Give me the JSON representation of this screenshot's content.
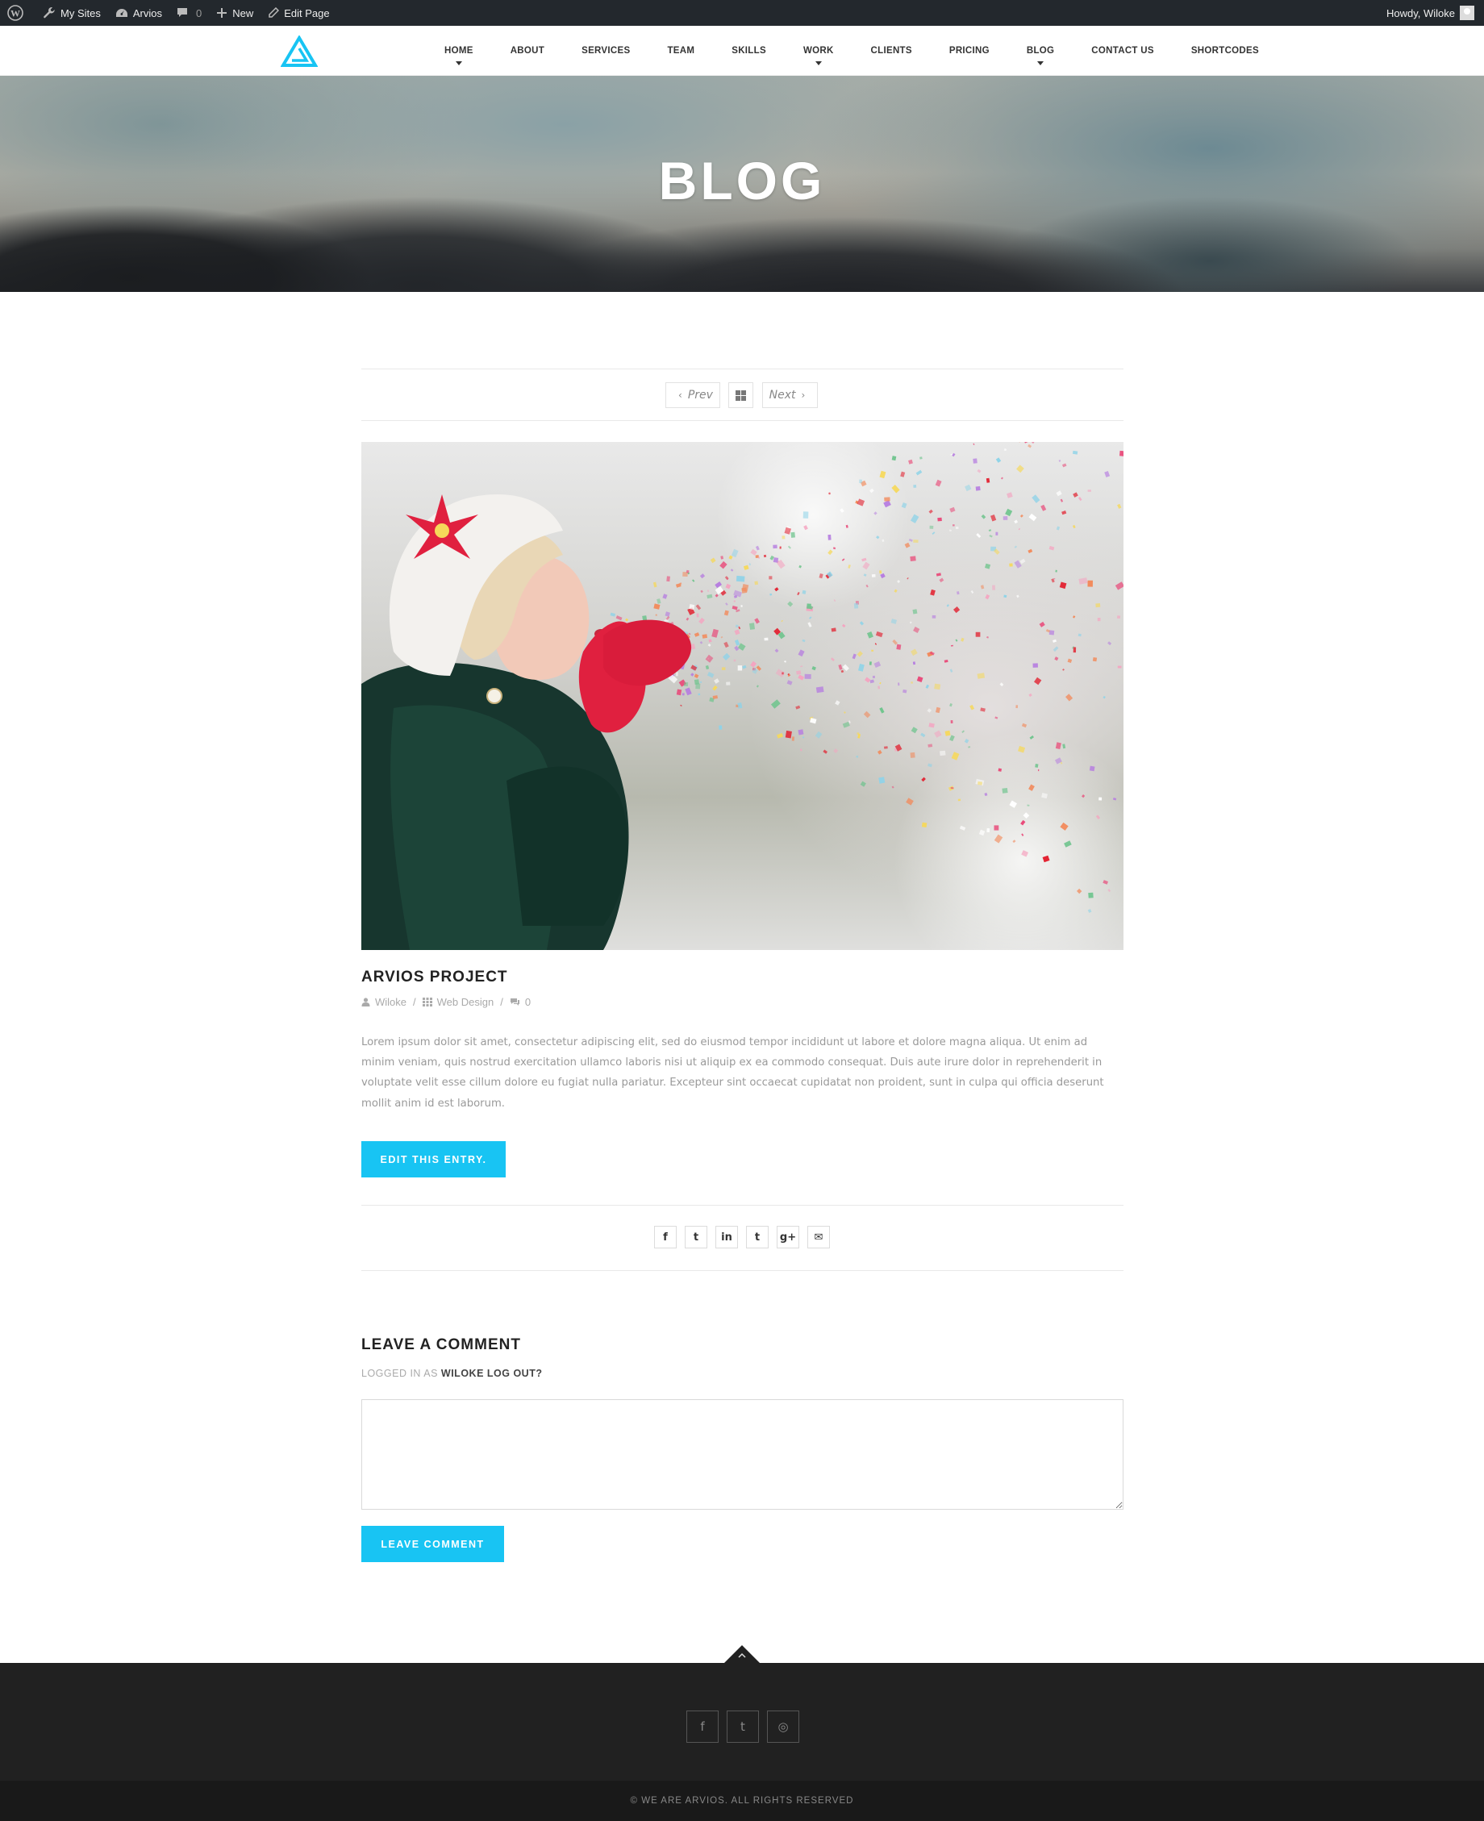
{
  "admin_bar": {
    "my_sites": "My Sites",
    "site_name": "Arvios",
    "comments_count": "0",
    "new_label": "New",
    "edit_page": "Edit Page",
    "greeting": "Howdy, Wiloke"
  },
  "nav": {
    "items": [
      {
        "label": "HOME",
        "has_submenu": true
      },
      {
        "label": "ABOUT",
        "has_submenu": false
      },
      {
        "label": "SERVICES",
        "has_submenu": false
      },
      {
        "label": "TEAM",
        "has_submenu": false
      },
      {
        "label": "SKILLS",
        "has_submenu": false
      },
      {
        "label": "WORK",
        "has_submenu": true
      },
      {
        "label": "CLIENTS",
        "has_submenu": false
      },
      {
        "label": "PRICING",
        "has_submenu": false
      },
      {
        "label": "BLOG",
        "has_submenu": true
      },
      {
        "label": "CONTACT US",
        "has_submenu": false
      },
      {
        "label": "SHORTCODES",
        "has_submenu": false
      }
    ]
  },
  "hero": {
    "title": "BLOG"
  },
  "post_nav": {
    "prev": "Prev",
    "next": "Next"
  },
  "post": {
    "title": "ARVIOS PROJECT",
    "author": "Wiloke",
    "category": "Web Design",
    "comments": "0",
    "body": "Lorem ipsum dolor sit amet, consectetur adipiscing elit, sed do eiusmod tempor incididunt ut labore et dolore magna aliqua. Ut enim ad minim veniam, quis nostrud exercitation ullamco laboris nisi ut aliquip ex ea commodo consequat. Duis aute irure dolor in reprehenderit in voluptate velit esse cillum dolore eu fugiat nulla pariatur. Excepteur sint occaecat cupidatat non proident, sunt in culpa qui officia deserunt mollit anim id est laborum.",
    "edit_button": "EDIT THIS ENTRY."
  },
  "share": {
    "icons": [
      {
        "name": "facebook-icon",
        "glyph": "f"
      },
      {
        "name": "twitter-icon",
        "glyph": "t"
      },
      {
        "name": "linkedin-icon",
        "glyph": "in"
      },
      {
        "name": "tumblr-icon",
        "glyph": "t"
      },
      {
        "name": "google-plus-icon",
        "glyph": "g+"
      },
      {
        "name": "email-icon",
        "glyph": "✉"
      }
    ]
  },
  "comment": {
    "heading": "LEAVE A COMMENT",
    "logged_prefix": "LOGGED IN AS",
    "logged_user": "WILOKE",
    "logout": "LOG OUT?",
    "submit": "LEAVE COMMENT"
  },
  "footer": {
    "icons": [
      {
        "name": "facebook-icon",
        "glyph": "f"
      },
      {
        "name": "twitter-icon",
        "glyph": "t"
      },
      {
        "name": "dribbble-icon",
        "glyph": "◎"
      }
    ],
    "copyright": "© WE ARE ARVIOS. ALL RIGHTS RESERVED"
  },
  "colors": {
    "accent": "#18c4f3",
    "admin_bar": "#23282d",
    "footer": "#212121",
    "footer_bottom": "#191919"
  }
}
